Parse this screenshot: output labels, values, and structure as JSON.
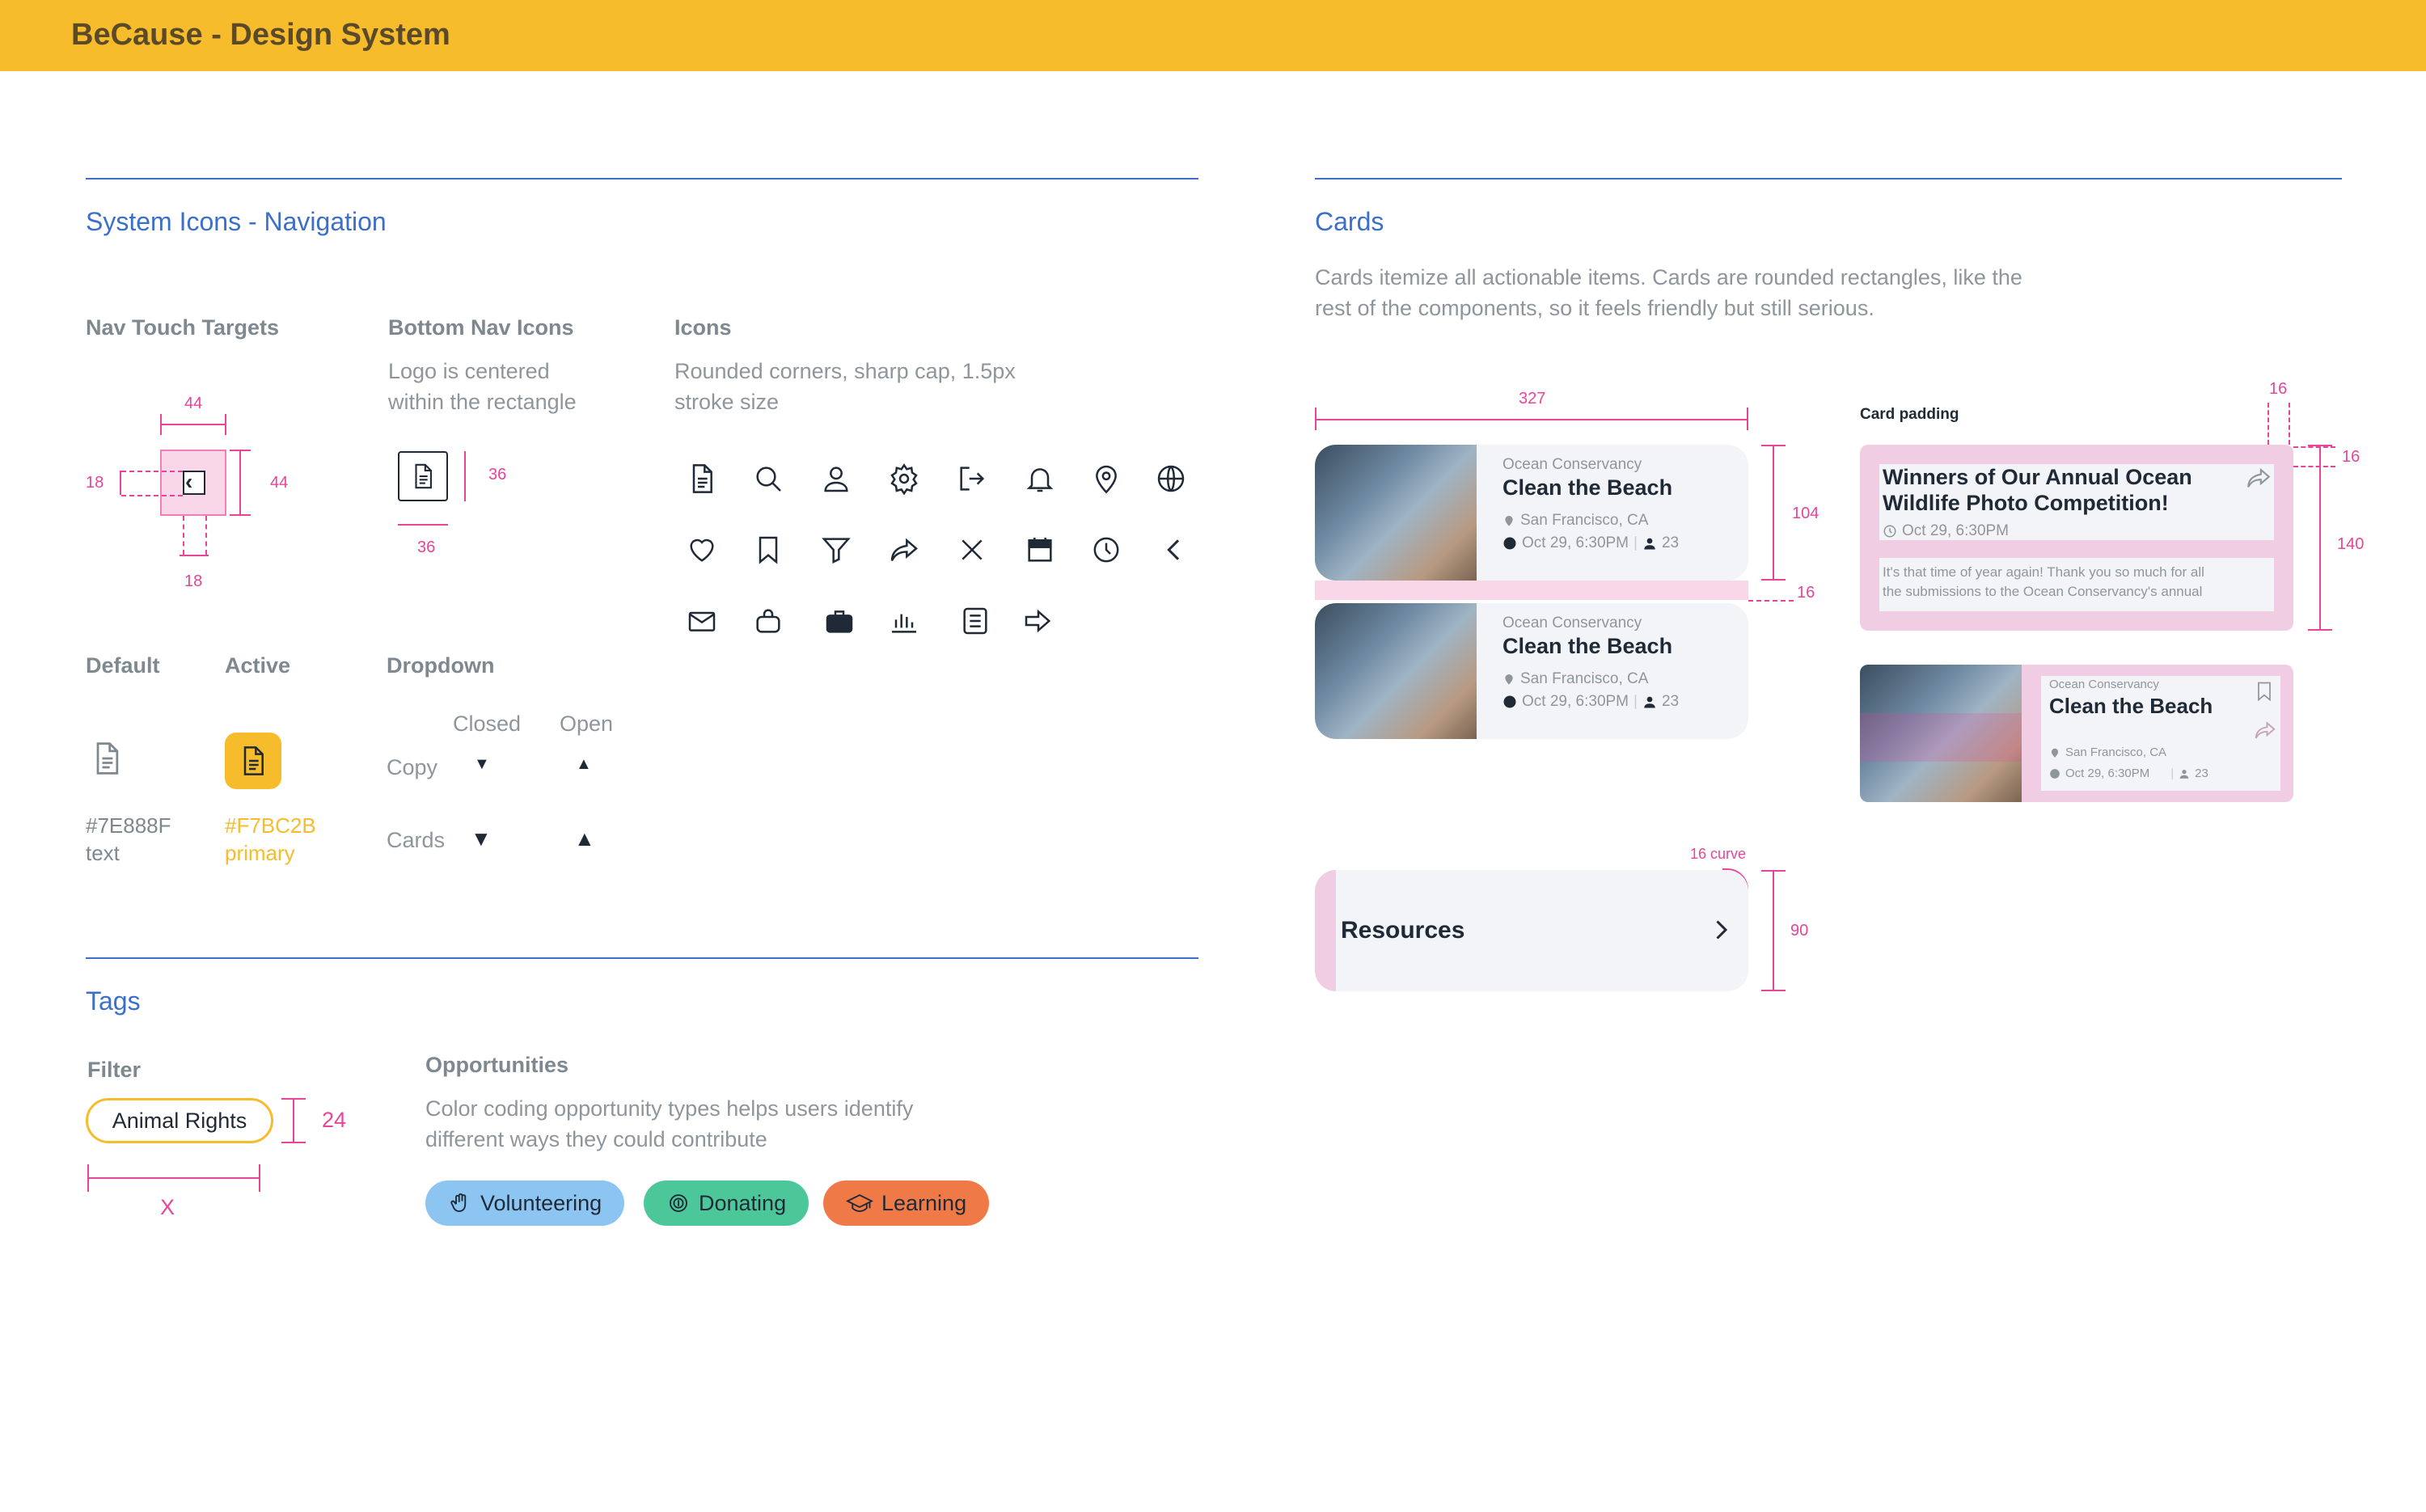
{
  "header": {
    "title": "BeCause - Design System"
  },
  "nav_section": {
    "title": "System Icons - Navigation",
    "touch_targets": {
      "title": "Nav Touch Targets",
      "dim_top": "44",
      "dim_right": "44",
      "dim_left": "18",
      "dim_bottom": "18"
    },
    "bottom_nav": {
      "title": "Bottom Nav Icons",
      "desc_line1": "Logo is centered",
      "desc_line2": "within the rectangle",
      "dim_right": "36",
      "dim_bottom": "36"
    },
    "icons": {
      "title": "Icons",
      "desc_line1": "Rounded corners, sharp cap, 1.5px",
      "desc_line2": "stroke size"
    },
    "default": {
      "title": "Default",
      "color": "#7E888F",
      "label": "text"
    },
    "active": {
      "title": "Active",
      "color": "#F7BC2B",
      "label": "primary"
    },
    "dropdown": {
      "title": "Dropdown",
      "closed": "Closed",
      "open": "Open",
      "row1": "Copy",
      "row2": "Cards"
    }
  },
  "tags_section": {
    "title": "Tags",
    "filter": {
      "title": "Filter",
      "tag": "Animal Rights",
      "height": "24",
      "width": "X"
    },
    "opportunities": {
      "title": "Opportunities",
      "desc_line1": "Color coding opportunity types helps users identify",
      "desc_line2": "different ways they could contribute",
      "tags": [
        {
          "label": "Volunteering",
          "color": "#8CC4F2"
        },
        {
          "label": "Donating",
          "color": "#4CC79A"
        },
        {
          "label": "Learning",
          "color": "#F07A47"
        }
      ]
    }
  },
  "cards_section": {
    "title": "Cards",
    "desc_line1": "Cards itemize all actionable items. Cards are rounded rectangles, like the",
    "desc_line2": "rest of the components, so it feels friendly but still serious.",
    "dim_width": "327",
    "dim_height": "104",
    "dim_gap": "16",
    "event_card": {
      "org": "Ocean Conservancy",
      "title": "Clean the Beach",
      "location": "San Francisco, CA",
      "time": "Oct 29, 6:30PM",
      "count": "23"
    },
    "padding": {
      "title": "Card padding",
      "dim_top": "16",
      "dim_right": "16",
      "dim_height": "140",
      "post_title_line1": "Winners of Our Annual Ocean",
      "post_title_line2": "Wildlife Photo Competition!",
      "post_time": "Oct 29, 6:30PM",
      "post_body_line1": "It's that time of year again! Thank you so much for all",
      "post_body_line2": "the submissions to the Ocean Conservancy's annual"
    },
    "resources": {
      "label": "Resources",
      "curve": "16 curve",
      "dim_height": "90"
    }
  }
}
